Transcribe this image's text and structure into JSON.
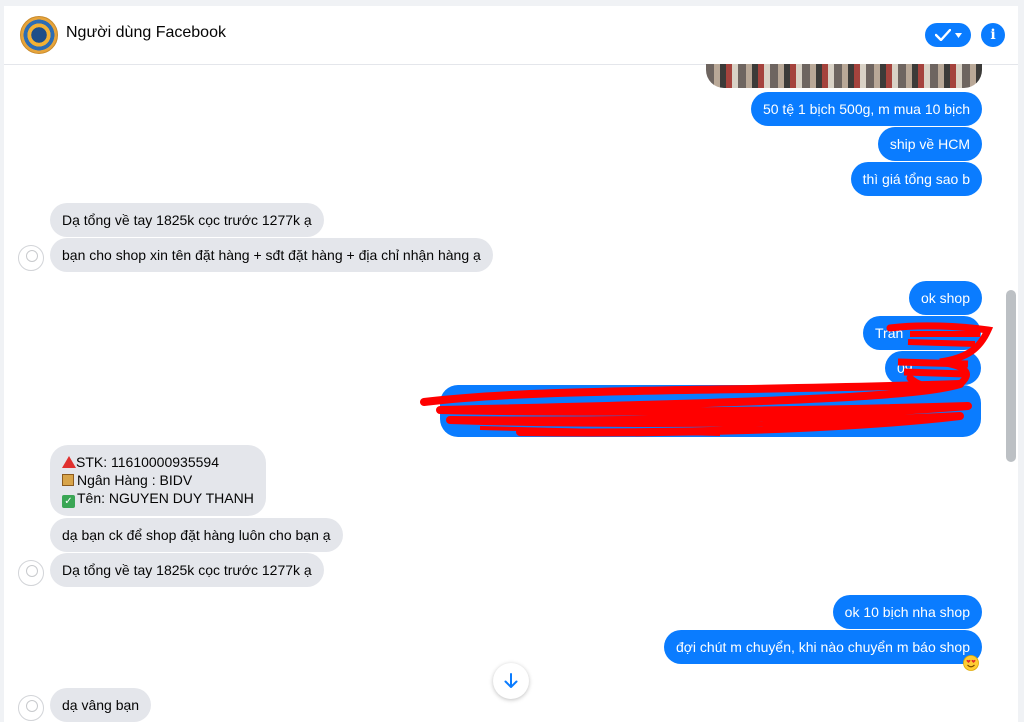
{
  "header": {
    "title": "Người dùng Facebook",
    "icons": {
      "status": "check-dropdown-icon",
      "info": "info-icon"
    }
  },
  "messages": [
    {
      "side": "out",
      "text": "50 tệ 1 bịch 500g, m mua 10 bịch"
    },
    {
      "side": "out",
      "text": "ship về HCM"
    },
    {
      "side": "out",
      "text": "thì giá tổng sao b"
    },
    {
      "side": "in",
      "text": "Dạ tổng về tay 1825k cọc trước 1277k ạ"
    },
    {
      "side": "in",
      "text": "bạn cho shop xin tên đặt hàng + sđt đặt hàng + địa chỉ nhận hàng ạ"
    },
    {
      "side": "out",
      "text": "ok shop"
    },
    {
      "side": "out",
      "text": "Trần"
    },
    {
      "side": "out",
      "text": "09"
    },
    {
      "side": "in",
      "lines": [
        "STK: 11610000935594",
        "Ngân Hàng : BIDV",
        "Tên: NGUYEN DUY THANH"
      ]
    },
    {
      "side": "in",
      "text": "dạ bạn ck để shop đặt hàng luôn cho bạn ạ"
    },
    {
      "side": "in",
      "text": "Dạ tổng về tay 1825k cọc trước 1277k ạ"
    },
    {
      "side": "out",
      "text": "ok 10 bịch nha shop"
    },
    {
      "side": "out",
      "text": "đợi chút m chuyển, khi nào chuyển m báo shop"
    },
    {
      "side": "in",
      "text": "dạ vâng bạn"
    }
  ],
  "colors": {
    "outgoing_bubble": "#0a7cff",
    "incoming_bubble": "#e4e6eb",
    "redaction": "#ff0000"
  }
}
